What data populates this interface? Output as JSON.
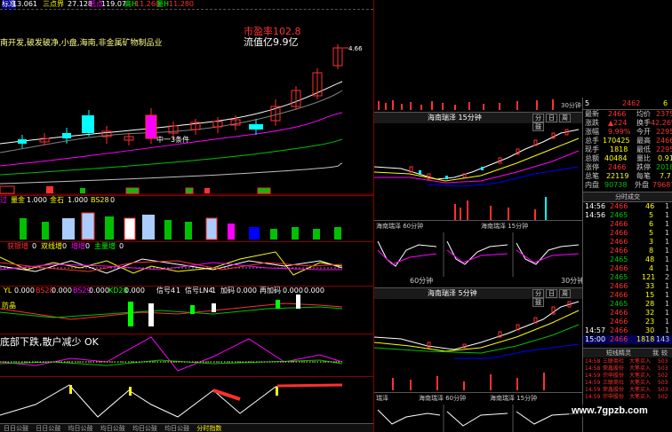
{
  "top_strip": {
    "label_a": "标准",
    "items": [
      "13.061",
      "三点界",
      "27.128",
      "低点",
      "119.07",
      "高H",
      "11.260",
      "量H",
      "11.280"
    ]
  },
  "main_chart": {
    "description_text": "南开发,破发破净,小盘,海南,非金属矿物制品业",
    "pe_label": "市盈率102.8",
    "mcap_label": "流值亿9.9亿",
    "price_marker": "4.66",
    "annotation": "中一3条件"
  },
  "volume_bar": {
    "labels": [
      "过",
      "量金",
      "1.000",
      "金石",
      "1.000",
      "BS28",
      "0"
    ]
  },
  "indicator_1": {
    "header": [
      "获银增",
      "0",
      "双线增",
      "0",
      "增增",
      "0",
      "主量增",
      "0"
    ]
  },
  "indicator_2": {
    "header": [
      "YL",
      "0.000",
      "BS28",
      "0.000",
      "BS29",
      "0.000",
      "KD28",
      "0.000",
      "信号4",
      "1",
      "信号LN4",
      "1",
      "加码",
      "0.000",
      "再加码",
      "0.000",
      "0.000"
    ],
    "side_label": "防晶"
  },
  "indicator_3": {
    "message": "底部下跌,散户减少 OK"
  },
  "bottom_tabs": [
    "日日公鼓",
    "日日公鼓",
    "均日公鼓",
    "均日公鼓",
    "均日公鼓",
    "均日公鼓",
    "分时指数"
  ],
  "mini_charts": {
    "top_title": "海南瑞泽 15分钟",
    "top_right_label": "30分钟",
    "tab_labels": [
      "分",
      "日",
      "周",
      "鼓"
    ],
    "row1_left": "海南瑞泽 60分钟",
    "row1_right": "海南瑞泽 15分钟",
    "middle_title": "海南瑞泽 5分钟",
    "middle_right_label": "30分钟",
    "row2_left": "海南瑞泽 60分钟",
    "row2_right": "海南瑞泽 15分钟",
    "mid_tabs": [
      "60分钟",
      "30分钟"
    ],
    "bottom_left_label": "瑞泽"
  },
  "quote": {
    "top_numbers": [
      {
        "k": "5",
        "v": "2462",
        "v2": "6"
      }
    ],
    "rows": [
      {
        "l1": "最新",
        "v1": "2466",
        "l2": "均价",
        "v2": "2375"
      },
      {
        "l1": "涨跌",
        "v1": "▲224",
        "l2": "换手",
        "v2": "42.26%"
      },
      {
        "l1": "涨幅",
        "v1": "9.99%",
        "l2": "今开",
        "v2": "2295"
      },
      {
        "l1": "总手",
        "v1": "170425",
        "l2": "最高",
        "v2": "2466"
      },
      {
        "l1": "现手",
        "v1": "1818",
        "l2": "最低",
        "v2": "2295"
      },
      {
        "l1": "总额",
        "v1": "40484",
        "l2": "量比",
        "v2": "0.91"
      },
      {
        "l1": "涨停",
        "v1": "2466",
        "l2": "跌停",
        "v2": "2018"
      },
      {
        "l1": "总笔",
        "v1": "22119",
        "l2": "每笔",
        "v2": "7.7"
      },
      {
        "l1": "内盘",
        "v1": "90738",
        "l2": "外盘",
        "v2": "79687"
      }
    ],
    "tab_title": "分时成交"
  },
  "trades": [
    {
      "t": "14:56",
      "p": "2466",
      "v": "46",
      "n": "1"
    },
    {
      "t": "14:56",
      "p": "2465",
      "v": "5",
      "n": "1"
    },
    {
      "t": "",
      "p": "2466",
      "v": "6",
      "n": "1"
    },
    {
      "t": "",
      "p": "2466",
      "v": "5",
      "n": "1"
    },
    {
      "t": "",
      "p": "2466",
      "v": "3",
      "n": "1"
    },
    {
      "t": "",
      "p": "2466",
      "v": "8",
      "n": "1"
    },
    {
      "t": "",
      "p": "2465",
      "v": "48",
      "n": "1"
    },
    {
      "t": "",
      "p": "2466",
      "v": "4",
      "n": "1"
    },
    {
      "t": "",
      "p": "2465",
      "v": "121",
      "n": "2"
    },
    {
      "t": "",
      "p": "2466",
      "v": "33",
      "n": "1"
    },
    {
      "t": "",
      "p": "2466",
      "v": "15",
      "n": "1"
    },
    {
      "t": "",
      "p": "2465",
      "v": "28",
      "n": "1"
    },
    {
      "t": "",
      "p": "2466",
      "v": "32",
      "n": "1"
    },
    {
      "t": "",
      "p": "2466",
      "v": "23",
      "n": "1"
    },
    {
      "t": "14:57",
      "p": "2466",
      "v": "30",
      "n": "1"
    },
    {
      "t": "15:00",
      "p": "2466",
      "v": "1818",
      "n": "143"
    }
  ],
  "elves": {
    "title": "短线精灵",
    "tabs": [
      "我",
      "较"
    ],
    "items": [
      {
        "t": "14:58",
        "name": "三联商社",
        "act": "大笔买入",
        "v": "503"
      },
      {
        "t": "14:58",
        "name": "荣鑫股份",
        "act": "大笔买入",
        "v": "503"
      },
      {
        "t": "14:59",
        "name": "宗申股份",
        "act": "大笔买入",
        "v": "502"
      },
      {
        "t": "14:59",
        "name": "三联商社",
        "act": "大笔买入",
        "v": "503"
      },
      {
        "t": "14:59",
        "name": "荣鑫股份",
        "act": "大笔买入",
        "v": "503"
      },
      {
        "t": "14:59",
        "name": "宗申股份",
        "act": "大笔买入",
        "v": "502"
      }
    ]
  },
  "watermark": {
    "text": "www.7gpzb.com"
  },
  "colors": {
    "up": "#ff3030",
    "down": "#00c000",
    "cyan": "#00ffff",
    "yellow": "#ffff00",
    "grid": "#8b0000",
    "magenta": "#ff00ff"
  }
}
